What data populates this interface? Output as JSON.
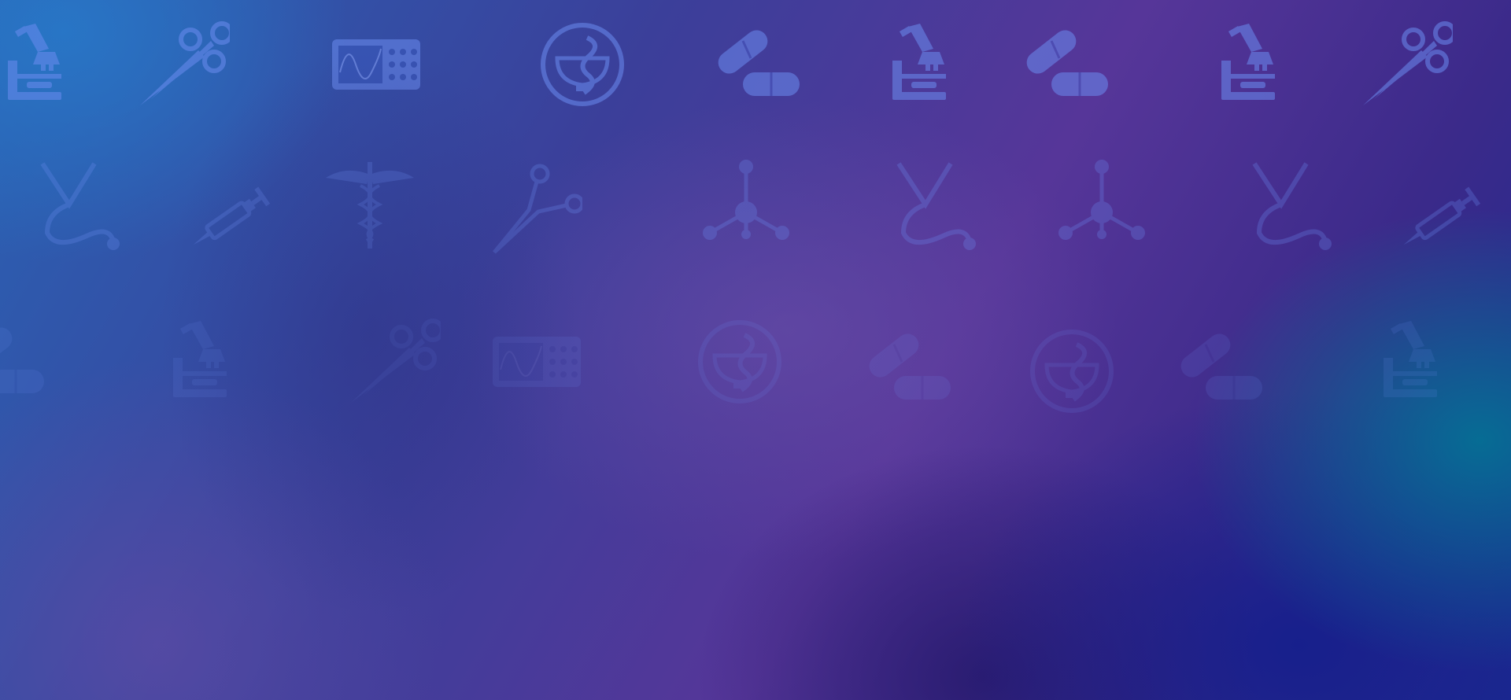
{
  "background": {
    "colors": {
      "top_left": "#2a63b4",
      "center": "#563699",
      "bottom_right": "#1c2a90",
      "accent_teal": "#00788f",
      "icon_fill": "#5a7be0"
    },
    "icon_rows": [
      [
        "microscope-icon",
        "scissors-icon",
        "oscilloscope-icon",
        "pharmacy-snake-bowl-icon",
        "pills-icon",
        "microscope-icon",
        "pills-icon",
        "microscope-icon",
        "scissors-icon"
      ],
      [
        "stethoscope-icon",
        "syringe-icon",
        "caduceus-icon",
        "forceps-icon",
        "molecule-icon",
        "stethoscope-icon",
        "molecule-icon",
        "stethoscope-icon",
        "syringe-icon"
      ],
      [
        "pills-icon",
        "microscope-icon",
        "scissors-icon",
        "oscilloscope-icon",
        "pharmacy-snake-bowl-icon",
        "pills-icon",
        "pharmacy-snake-bowl-icon",
        "pills-icon",
        "microscope-icon"
      ]
    ]
  }
}
